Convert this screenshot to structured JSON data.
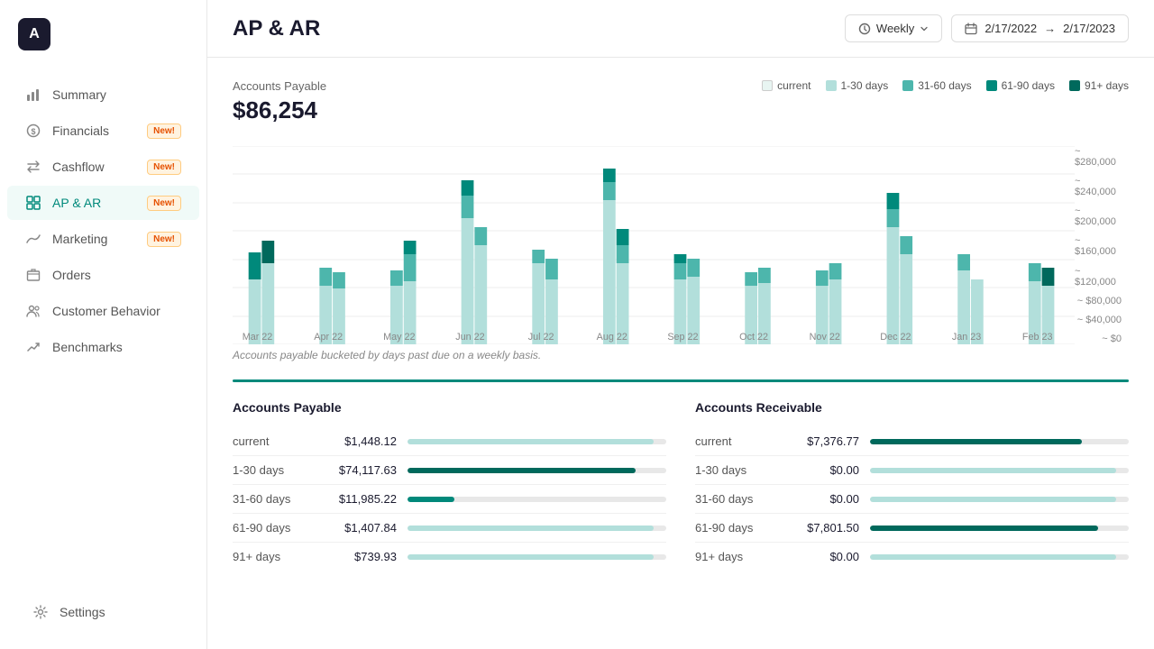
{
  "app": {
    "logo": "A",
    "title": "AP & AR"
  },
  "sidebar": {
    "items": [
      {
        "id": "summary",
        "label": "Summary",
        "icon": "chart-icon",
        "badge": null,
        "active": false
      },
      {
        "id": "financials",
        "label": "Financials",
        "icon": "dollar-icon",
        "badge": "New!",
        "active": false
      },
      {
        "id": "cashflow",
        "label": "Cashflow",
        "icon": "arrows-icon",
        "badge": "New!",
        "active": false
      },
      {
        "id": "ap-ar",
        "label": "AP & AR",
        "icon": "grid-icon",
        "badge": "New!",
        "active": true
      },
      {
        "id": "marketing",
        "label": "Marketing",
        "icon": "signal-icon",
        "badge": "New!",
        "active": false
      },
      {
        "id": "orders",
        "label": "Orders",
        "icon": "box-icon",
        "badge": null,
        "active": false
      },
      {
        "id": "customer-behavior",
        "label": "Customer Behavior",
        "icon": "users-icon",
        "badge": null,
        "active": false
      },
      {
        "id": "benchmarks",
        "label": "Benchmarks",
        "icon": "trend-icon",
        "badge": null,
        "active": false
      }
    ],
    "bottom": [
      {
        "id": "settings",
        "label": "Settings",
        "icon": "gear-icon"
      }
    ]
  },
  "header": {
    "time_filter": "Weekly",
    "date_from": "2/17/2022",
    "date_to": "2/17/2023",
    "time_icon": "clock-icon",
    "calendar_icon": "calendar-icon",
    "chevron_icon": "chevron-down-icon",
    "arrow_icon": "arrow-right-icon"
  },
  "accounts_payable": {
    "label": "Accounts Payable",
    "value": "$86,254"
  },
  "legend": [
    {
      "label": "current",
      "color": "#e8f5f2"
    },
    {
      "label": "1-30 days",
      "color": "#b2dfdb"
    },
    {
      "label": "31-60 days",
      "color": "#4db6ac"
    },
    {
      "label": "61-90 days",
      "color": "#00897b"
    },
    {
      "label": "91+ days",
      "color": "#00695c"
    }
  ],
  "chart": {
    "y_labels": [
      "$280,000",
      "$240,000",
      "$200,000",
      "$160,000",
      "$120,000",
      "$80,000",
      "$40,000",
      "$0"
    ],
    "x_labels": [
      "Mar 22",
      "Apr 22",
      "May 22",
      "Jun 22",
      "Jul 22",
      "Aug 22",
      "Sep 22",
      "Oct 22",
      "Nov 22",
      "Dec 22",
      "Jan 23",
      "Feb 23"
    ],
    "note": "Accounts payable bucketed by days past due on a weekly basis."
  },
  "ap_table": {
    "title": "Accounts Payable",
    "rows": [
      {
        "label": "current",
        "value": "$1,448.12",
        "bar_pct": 95,
        "color": "#b2dfdb"
      },
      {
        "label": "1-30 days",
        "value": "$74,117.63",
        "bar_pct": 88,
        "color": "#00695c"
      },
      {
        "label": "31-60 days",
        "value": "$11,985.22",
        "bar_pct": 18,
        "color": "#00897b"
      },
      {
        "label": "61-90 days",
        "value": "$1,407.84",
        "bar_pct": 95,
        "color": "#b2dfdb"
      },
      {
        "label": "91+ days",
        "value": "$739.93",
        "bar_pct": 95,
        "color": "#b2dfdb"
      }
    ]
  },
  "ar_table": {
    "title": "Accounts Receivable",
    "rows": [
      {
        "label": "current",
        "value": "$7,376.77",
        "bar_pct": 82,
        "color": "#00695c"
      },
      {
        "label": "1-30 days",
        "value": "$0.00",
        "bar_pct": 95,
        "color": "#b2dfdb"
      },
      {
        "label": "31-60 days",
        "value": "$0.00",
        "bar_pct": 95,
        "color": "#b2dfdb"
      },
      {
        "label": "61-90 days",
        "value": "$7,801.50",
        "bar_pct": 88,
        "color": "#00695c"
      },
      {
        "label": "91+ days",
        "value": "$0.00",
        "bar_pct": 95,
        "color": "#b2dfdb"
      }
    ]
  }
}
